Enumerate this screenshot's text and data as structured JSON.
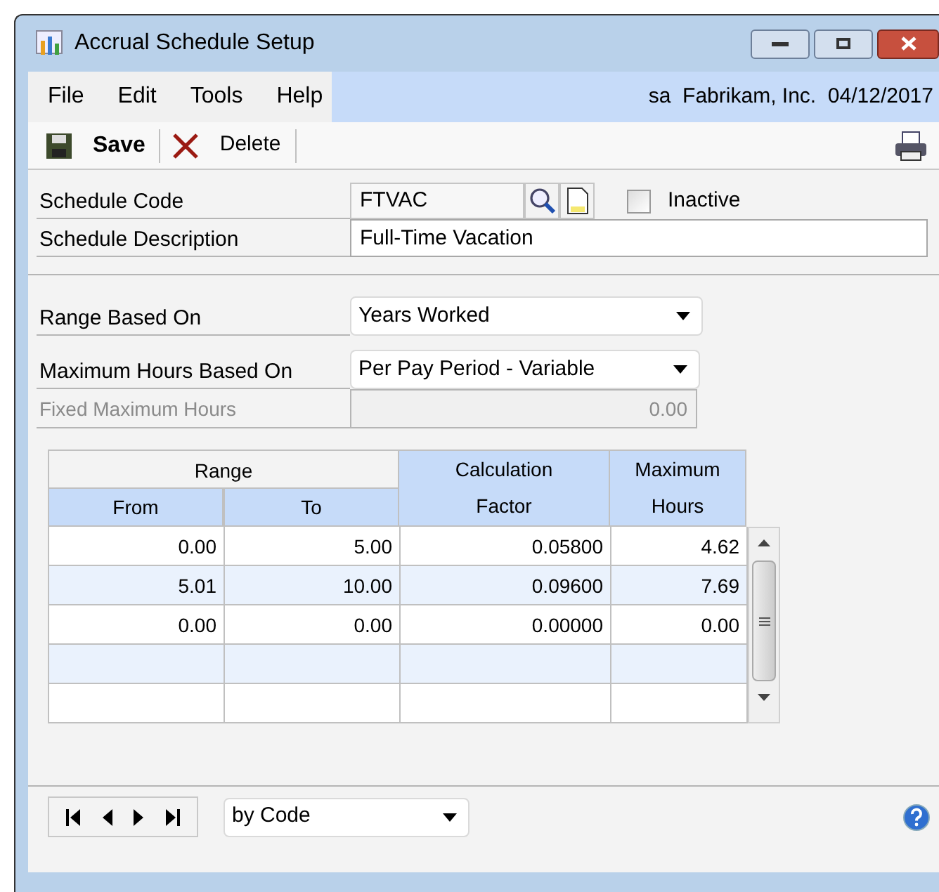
{
  "window": {
    "title": "Accrual Schedule Setup"
  },
  "menu": [
    "File",
    "Edit",
    "Tools",
    "Help"
  ],
  "user_info": "sa  Fabrikam, Inc.  04/12/2017",
  "toolbar": [
    {
      "kind": "save",
      "label": "Save"
    },
    {
      "kind": "delete",
      "label": "Delete"
    }
  ],
  "schedule_code": {
    "label": "Schedule Code",
    "value": "FTVAC"
  },
  "inactive": {
    "label": "Inactive",
    "checked": false
  },
  "schedule_description": {
    "label": "Schedule Description",
    "value": "Full-Time Vacation"
  },
  "range_based_on": {
    "label": "Range Based On",
    "value": "Years Worked"
  },
  "maximum_hours_based_on": {
    "label": "Maximum Hours Based On",
    "value": "Per Pay Period - Variable"
  },
  "fixed_maximum_hours": {
    "label": "Fixed Maximum Hours",
    "value": "0.00",
    "disabled": true
  },
  "table": {
    "group_header": "Range",
    "columns": [
      {
        "top": "Calculation",
        "bottom": "Factor"
      },
      {
        "top": "Maximum",
        "bottom": "Hours"
      }
    ],
    "range_columns": [
      "From",
      "To"
    ],
    "rows": [
      {
        "cells": [
          "0.00",
          "5.00",
          "0.05800",
          "4.62"
        ]
      },
      {
        "cells": [
          "5.01",
          "10.00",
          "0.09600",
          "7.69"
        ]
      },
      {
        "cells": [
          "0.00",
          "0.00",
          "0.00000",
          "0.00"
        ]
      }
    ]
  },
  "sort_by": {
    "value": "by Code"
  }
}
